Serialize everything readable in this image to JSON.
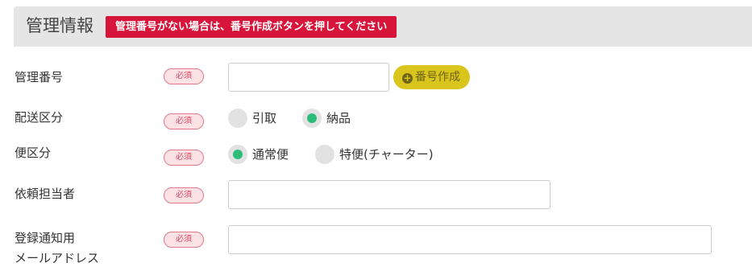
{
  "section": {
    "title": "管理情報",
    "notice": "管理番号がない場合は、番号作成ボタンを押してください"
  },
  "required_label": "必須",
  "fields": {
    "management_number": {
      "label": "管理番号",
      "value": "",
      "button_label": "番号作成",
      "button_icon": "plus-circle-icon"
    },
    "delivery_type": {
      "label": "配送区分",
      "options": [
        {
          "label": "引取",
          "checked": false
        },
        {
          "label": "納品",
          "checked": true
        }
      ]
    },
    "shipping_type": {
      "label": "便区分",
      "options": [
        {
          "label": "通常便",
          "checked": true
        },
        {
          "label": "特便(チャーター)",
          "checked": false
        }
      ]
    },
    "person_in_charge": {
      "label": "依頼担当者",
      "value": ""
    },
    "notification_email": {
      "label_line1": "登録通知用",
      "label_line2": "メールアドレス",
      "value": ""
    }
  },
  "colors": {
    "header_bg": "#e5e5e5",
    "notice_bg": "#d7153a",
    "required_bg": "#fbe2e5",
    "required_text": "#e0465e",
    "button_bg": "#d9c51c",
    "radio_checked": "#2dbd7a",
    "radio_unchecked": "#e2e2e2"
  }
}
